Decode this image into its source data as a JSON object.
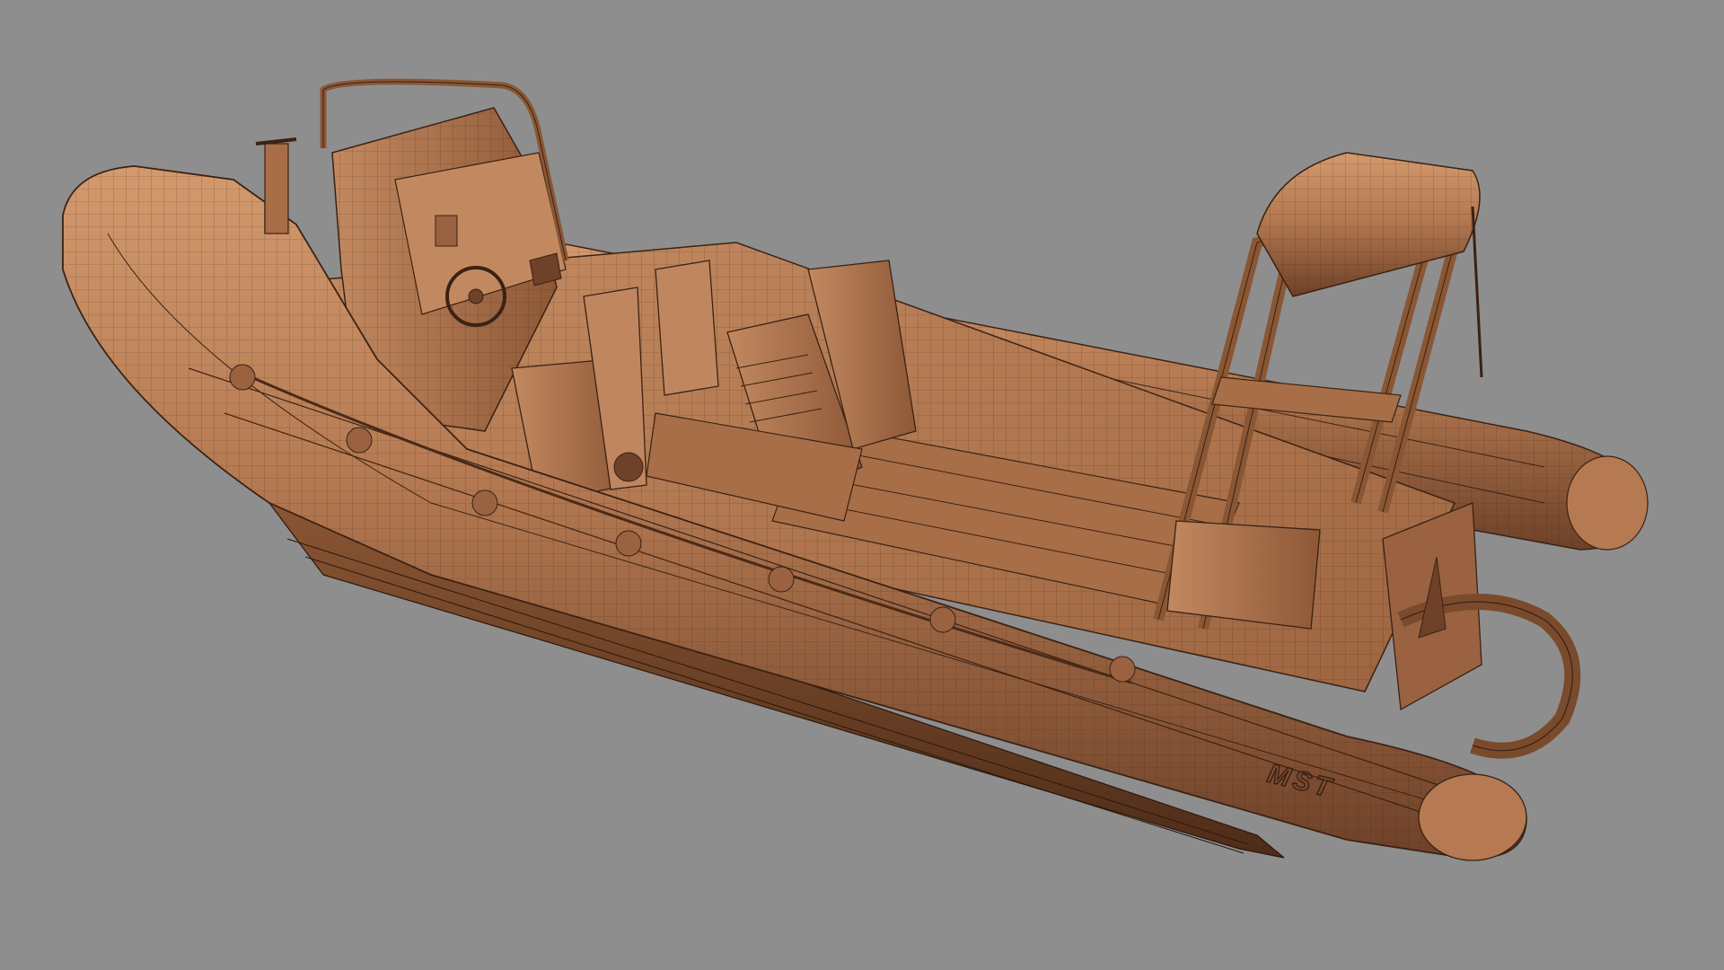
{
  "scene": {
    "background_color": "#8e8e8e",
    "model_color": "#b57a52",
    "model_shadow_color": "#6e4128",
    "model_highlight_color": "#d39a6e",
    "wire_color": "#3a2214",
    "view_mode": "wireframe-on-shaded"
  },
  "hull_marking": {
    "text": "MST"
  }
}
